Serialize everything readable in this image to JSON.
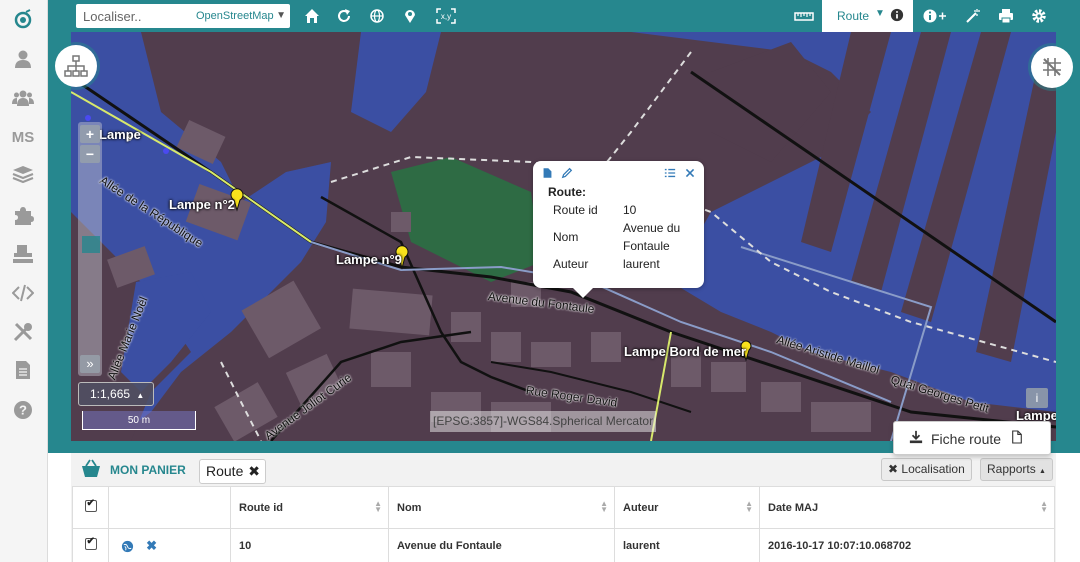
{
  "search": {
    "placeholder": "Localiser..",
    "layer": "OpenStreetMap"
  },
  "toolbar": {
    "route_tab_label": "Route"
  },
  "map": {
    "labels": [
      "Lampe",
      "Lampe n°2",
      "Lampe n°9",
      "Lampe Bord de mer",
      "Lampe"
    ],
    "streets": [
      "Allée de la République",
      "Avenue du Fontaule",
      "Allée Marie Noël",
      "Avenue Joliot Curie",
      "Rue Roger David",
      "Allée Aristide Maillol",
      "Quai Georges Petit"
    ],
    "zoom_in": "+",
    "zoom_out": "−",
    "expand": "»",
    "scale_ratio": "1:1,665",
    "scale_bar": "50 m",
    "projection": "[EPSG:3857]-WGS84.Spherical Mercator",
    "info_btn": "i"
  },
  "popup": {
    "title": "Route:",
    "fields": [
      {
        "key": "Route id",
        "value": "10"
      },
      {
        "key": "Nom",
        "value": "Avenue du Fontaule"
      },
      {
        "key": "Auteur",
        "value": "laurent"
      }
    ]
  },
  "fiche_menu": {
    "label": "Fiche route"
  },
  "panier": {
    "title": "MON PANIER",
    "chip": "Route",
    "localisation_btn": "Localisation",
    "rapports_btn": "Rapports"
  },
  "table": {
    "headers": [
      "Route id",
      "Nom",
      "Auteur",
      "Date MAJ"
    ],
    "rows": [
      {
        "route_id": "10",
        "nom": "Avenue du Fontaule",
        "auteur": "laurent",
        "date": "2016-10-17 10:07:10.068702"
      }
    ]
  },
  "colors": {
    "accent": "#26878e",
    "map_bg": "#513d4d",
    "water": "#3b4fa3"
  }
}
